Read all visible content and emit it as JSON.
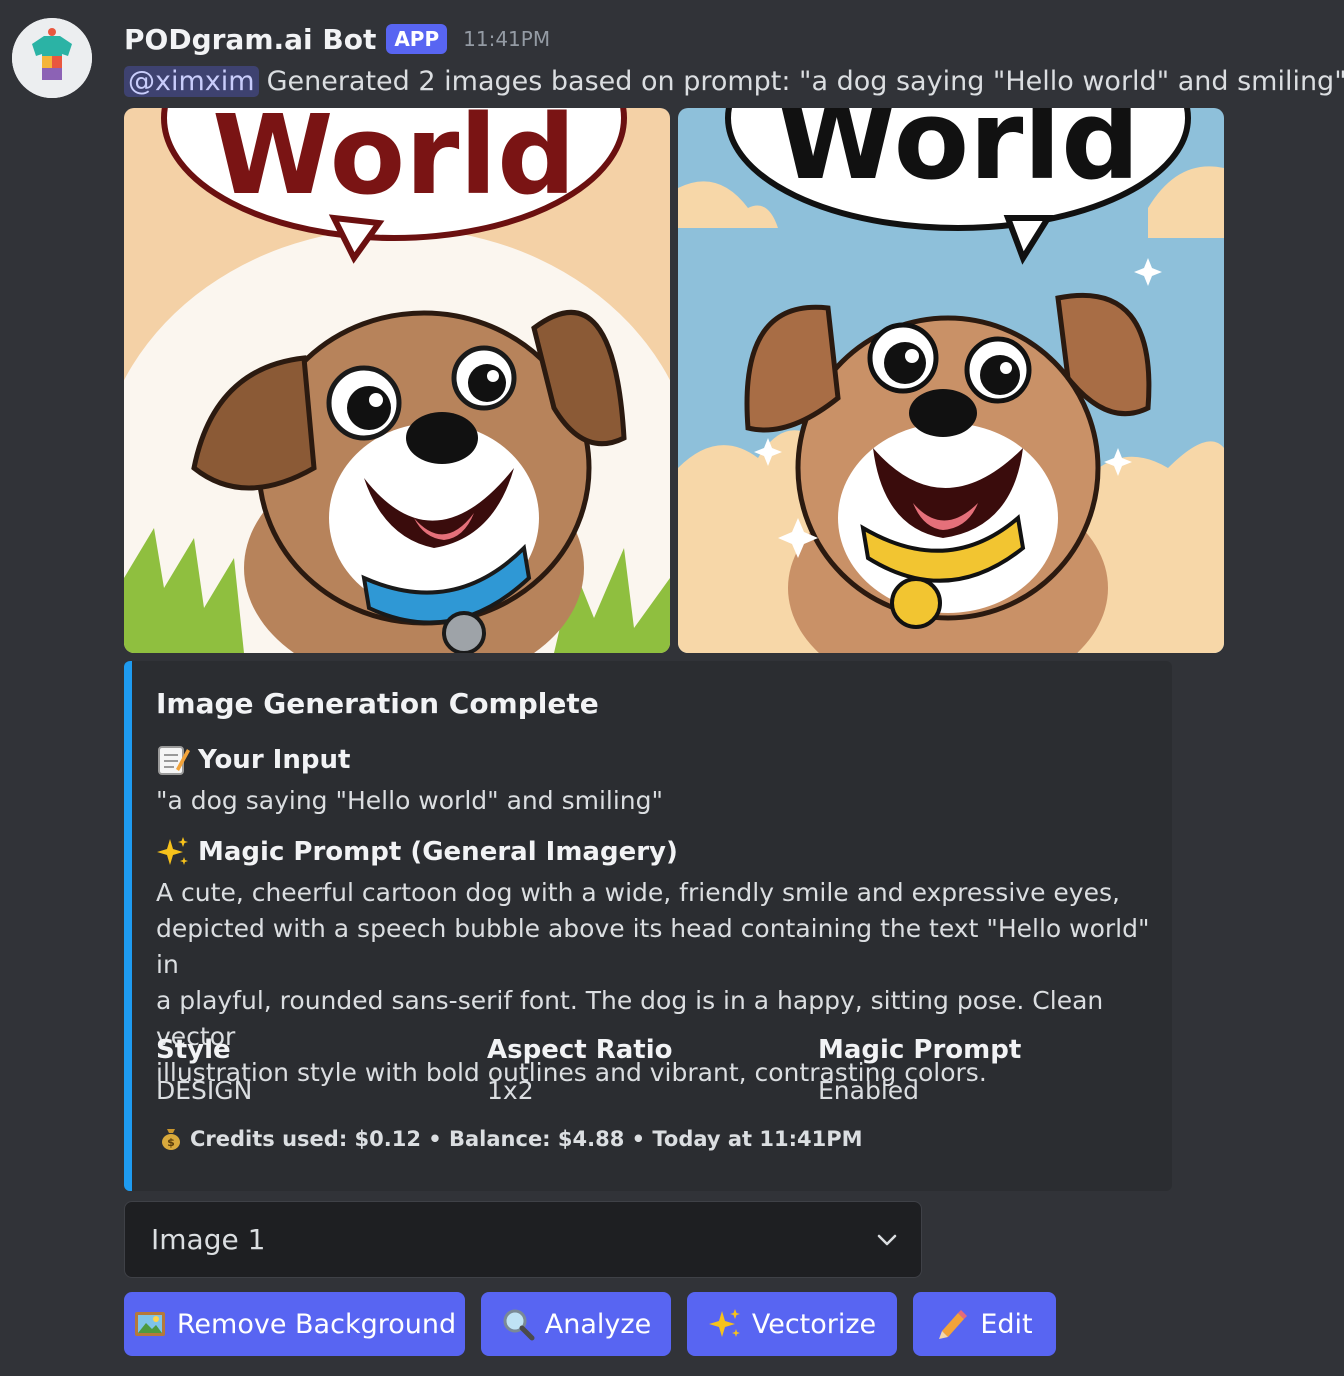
{
  "message": {
    "username": "PODgram.ai Bot",
    "badge": "APP",
    "time": "11:41PM",
    "mention": "@ximxim",
    "text": "Generated 2 images based on prompt: \"a dog saying \"Hello world\" and smiling\""
  },
  "images": [
    {
      "bubble_text": "World",
      "collar_color": "#3b9dd6",
      "bg_color": "#f4d1a6"
    },
    {
      "bubble_text": "World",
      "collar_color": "#f2c531",
      "bg_color": "#8ec0da"
    }
  ],
  "embed": {
    "title": "Image Generation Complete",
    "input_label": "Your Input",
    "input_value": "\"a dog saying \"Hello world\" and smiling\"",
    "magic_label": "Magic Prompt (General Imagery)",
    "magic_lines": [
      "A cute, cheerful cartoon dog with a wide, friendly smile and expressive eyes,",
      "depicted with a speech bubble above its head containing the text \"Hello world\" in",
      "a playful, rounded sans-serif font. The dog is in a happy, sitting pose. Clean vector",
      "illustration style with bold outlines and vibrant, contrasting colors."
    ],
    "fields": [
      {
        "name": "Style",
        "value": "DESIGN"
      },
      {
        "name": "Aspect Ratio",
        "value": "1x2"
      },
      {
        "name": "Magic Prompt",
        "value": "Enabled"
      }
    ],
    "footer": "Credits used: $0.12 • Balance: $4.88 • Today at 11:41PM",
    "accent_color": "#1e9bf0"
  },
  "select": {
    "value": "Image 1"
  },
  "buttons": [
    {
      "label": "Remove Background",
      "icon": "framed-picture-icon"
    },
    {
      "label": "Analyze",
      "icon": "magnifier-icon"
    },
    {
      "label": "Vectorize",
      "icon": "sparkles-icon"
    },
    {
      "label": "Edit",
      "icon": "pencil-icon"
    }
  ]
}
